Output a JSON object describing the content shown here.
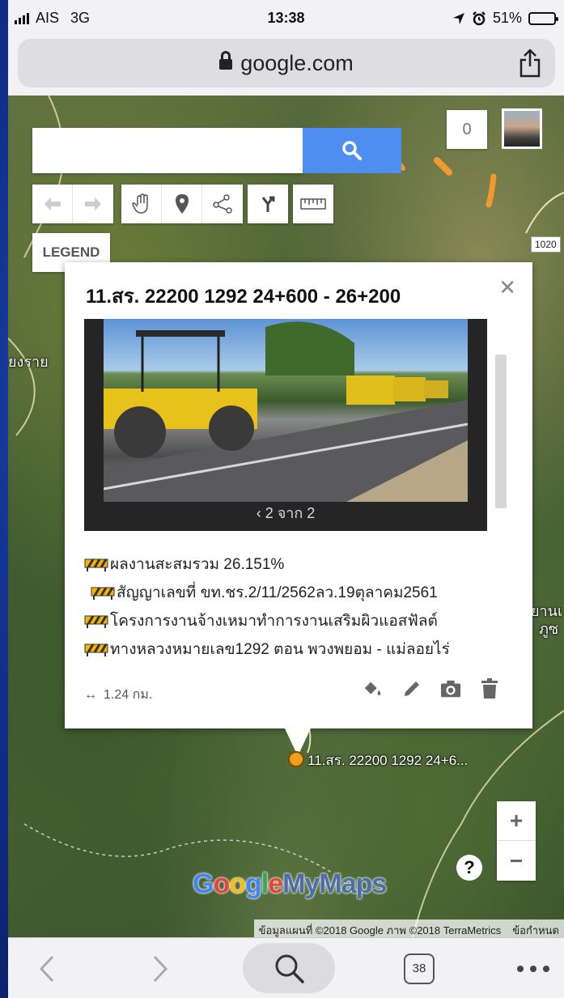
{
  "status_bar": {
    "carrier": "AIS",
    "network": "3G",
    "time": "13:38",
    "battery": "51%"
  },
  "browser": {
    "url": "google.com"
  },
  "map": {
    "road_shield": "1020",
    "place_labels": [
      "ยงราย",
      "ยานเ",
      "ภูซ"
    ],
    "marker_label": "11.สร. 22200 1292 24+6...",
    "attribution_data": "ข้อมูลแผนที่ ©2018 Google ภาพ ©2018 TerraMetrics",
    "attribution_terms": "ข้อกำหนด",
    "logo_text": [
      "Google",
      "My",
      "Maps"
    ],
    "logo_colors": [
      "#4285F4",
      "#EA4335",
      "#FBBC05",
      "#4285F4",
      "#34A853",
      "#EA4335"
    ]
  },
  "controls": {
    "search_placeholder": "",
    "legend_label": "LEGEND",
    "counter": "0",
    "zoom_in": "+",
    "zoom_out": "−",
    "help": "?"
  },
  "popup": {
    "title": "11.สร. 22200 1292 24+600 - 26+200",
    "gallery_nav": "‹  2 จาก 2",
    "lines": [
      "ผลงานสะสมรวม 26.151%",
      "สัญญาเลขที่ ขท.ชร.2/11/2562ลว.19ตุลาคม2561",
      "โครงการงานจ้างเหมาทำการงานเสริมผิวแอสฟัลต์",
      "ทางหลวงหมายเลข1292 ตอน พวงพยอม - แม่ลอยไร่"
    ],
    "distance": "1.24 กม."
  },
  "bottom_bar": {
    "tab_count": "38"
  }
}
